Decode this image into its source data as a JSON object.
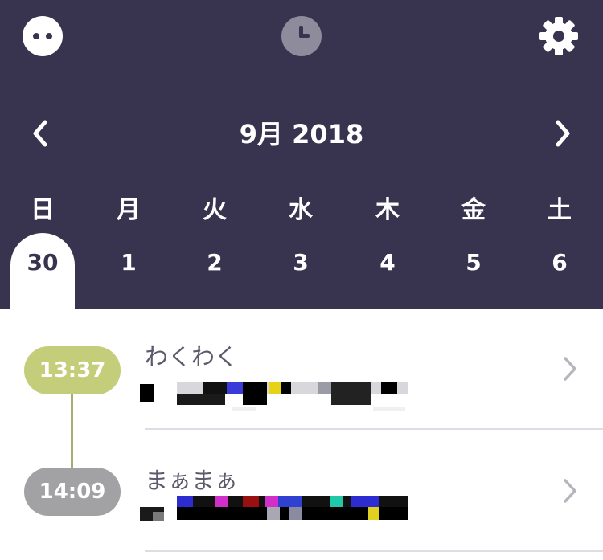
{
  "colors": {
    "header_bg": "#38334f",
    "badge_active": "#c4cd79",
    "badge_inactive": "#a2a2a4",
    "timeline_line": "#a7ad75"
  },
  "header": {
    "menu_icon": "dots-face-icon",
    "history_icon": "clock-icon",
    "settings_icon": "gear-icon",
    "month_title": "9月 2018",
    "prev_icon": "chevron-left-icon",
    "next_icon": "chevron-right-icon",
    "weekdays": [
      "日",
      "月",
      "火",
      "水",
      "木",
      "金",
      "土"
    ],
    "days": [
      "30",
      "1",
      "2",
      "3",
      "4",
      "5",
      "6"
    ],
    "selected_day_index": 0
  },
  "entries": [
    {
      "time": "13:37",
      "title": "わくわく",
      "badge_color": "#c4cd79"
    },
    {
      "time": "14:09",
      "title": "まぁまぁ",
      "badge_color": "#a2a2a4"
    }
  ]
}
